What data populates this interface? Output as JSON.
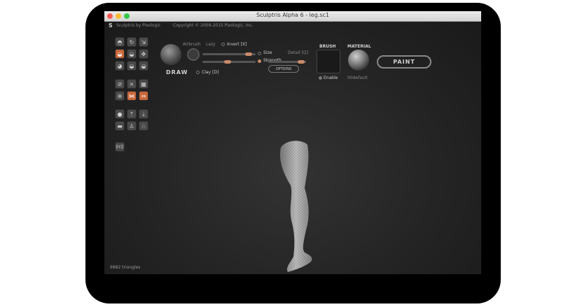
{
  "window": {
    "title": "Sculptris Alpha 6 - leg.sc1"
  },
  "infobar": {
    "app_name": "Sculptris by Pixologic",
    "copyright": "Copyright © 2009-2015 Pixologic, Inc."
  },
  "brush": {
    "name": "DRAW",
    "airbrush_label": "Airbrush",
    "lazy_label": "Lazy",
    "invert_label": "Invert [X]",
    "size_label": "Size",
    "detail_label": "Detail [Q]",
    "strength_label": "Strength",
    "clay_label": "Clay [D]",
    "options_label": "OPTIONS",
    "brush_header": "BRUSH",
    "enable_label": "Enable",
    "size_value": 0.8,
    "strength_value": 0.45,
    "detail_value": 0.6
  },
  "material": {
    "header": "MATERIAL",
    "name": "00default"
  },
  "paint_button": "PAINT",
  "sym_label": "SYZ",
  "status": {
    "triangles": "9882 triangles"
  },
  "colors": {
    "accent": "#c9673a",
    "canvas": "#242424"
  }
}
